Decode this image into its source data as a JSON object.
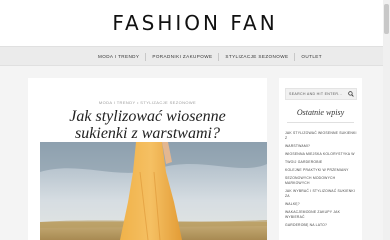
{
  "site": {
    "logo": "FASHION FAN"
  },
  "nav": {
    "items": [
      "MODA I TRENDY",
      "PORADNIKI ZAKUPOWE",
      "STYLIZACJE SEZONOWE",
      "OUTLET"
    ]
  },
  "post": {
    "categories": "MODA I TRENDY • STYLIZACJE SEZONOWE",
    "title": "Jak stylizować wiosenne sukienki z warstwami?"
  },
  "sidebar": {
    "search": {
      "placeholder": "SEARCH AND HIT ENTER..."
    },
    "widget_title": "Ostatnie wpisy",
    "recent_posts": [
      "JAK STYLIZOWAĆ WIOSENNE SUKIENKI Z",
      "WARSTWAMI?",
      "WIOSENNA MIEJSKA KOLORYSTYKA W",
      "TWOIJ GARDEROBIE",
      "KOLEJNE PRAKTYKI W PRZEMIANY",
      "SEZONOWYCH MODOWYCH MARKOWYCH",
      "JAK WYBRAĆ I STYLIZOWAĆ SUKIENKI ZA",
      "WALKĘ?",
      "WAKACJEMODNE ZAKUPY JAK WYBIERAĆ",
      "GARDEROBĘ NA LATO?"
    ]
  },
  "colors": {
    "accent": "#e8a33a",
    "sky": "#cfd6dc"
  }
}
